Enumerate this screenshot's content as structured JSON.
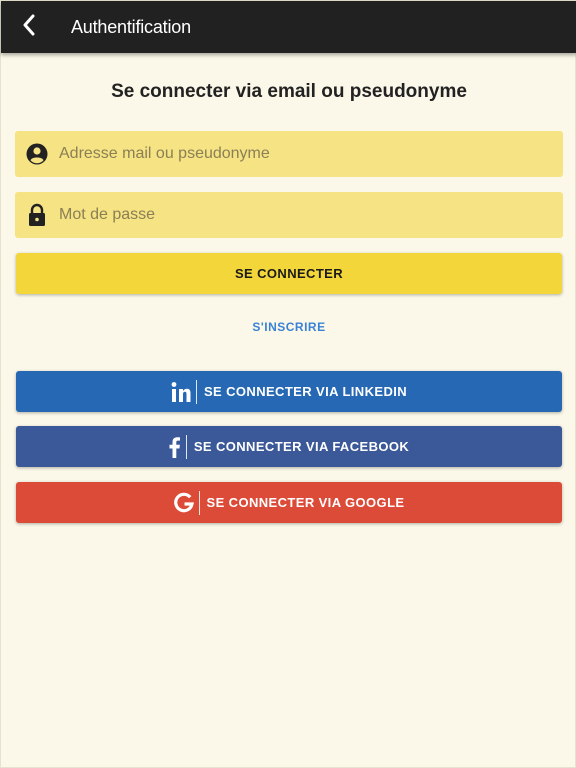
{
  "appbar": {
    "title": "Authentification",
    "back_icon": "chevron-left-icon"
  },
  "form": {
    "heading": "Se connecter via email ou pseudonyme",
    "identifier": {
      "placeholder": "Adresse mail ou pseudonyme",
      "value": "",
      "icon": "account-circle-icon"
    },
    "password": {
      "placeholder": "Mot de passe",
      "value": "",
      "icon": "lock-icon"
    },
    "submit_label": "SE CONNECTER",
    "signup_label": "S'INSCRIRE"
  },
  "social": [
    {
      "label": "SE CONNECTER VIA LINKEDIN",
      "icon": "linkedin-icon",
      "color": "#2668b4"
    },
    {
      "label": "SE CONNECTER VIA FACEBOOK",
      "icon": "facebook-icon",
      "color": "#3b5898"
    },
    {
      "label": "SE CONNECTER VIA GOOGLE",
      "icon": "google-icon",
      "color": "#dc4a38"
    }
  ],
  "colors": {
    "appbar": "#212121",
    "background": "#fbf8e9",
    "field": "#f5e384",
    "primary_button": "#f2d63a",
    "link": "#3b82d6"
  }
}
